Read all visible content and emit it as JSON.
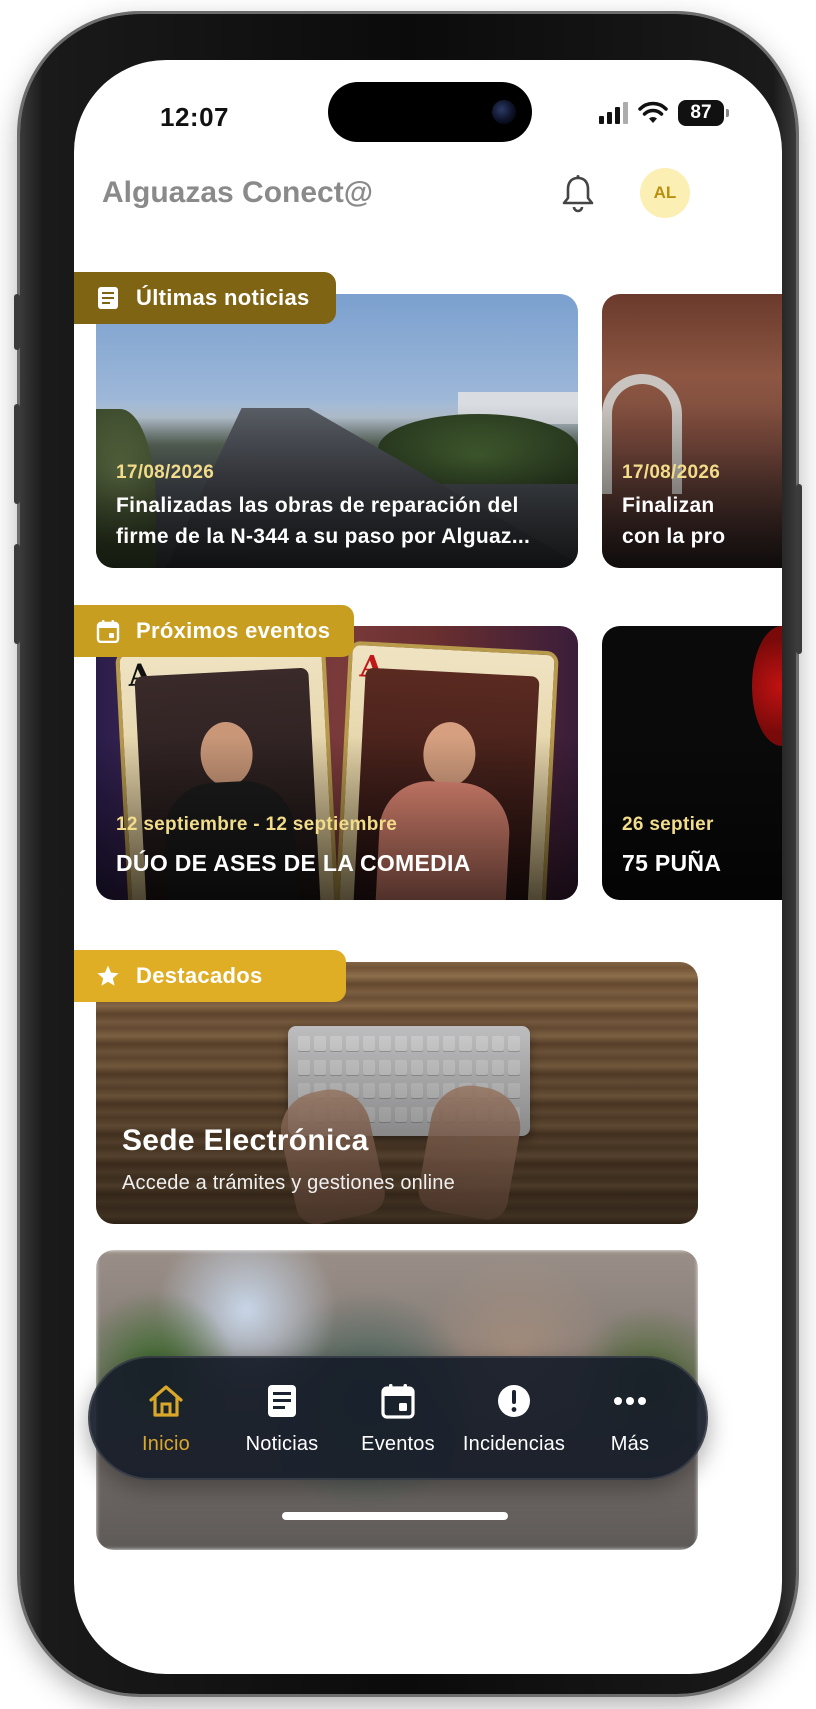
{
  "status_bar": {
    "time": "12:07",
    "battery": "87"
  },
  "app_bar": {
    "title": "Alguazas Conect@",
    "avatar_initials": "AL"
  },
  "sections": {
    "news": {
      "badge": "Últimas noticias",
      "items": [
        {
          "date": "17/08/2026",
          "title": "Finalizadas las obras de reparación del firme de la N-344 a su paso por Alguaz..."
        },
        {
          "date": "17/08/2026",
          "title": "Finalizan\ncon la pro"
        }
      ]
    },
    "events": {
      "badge": "Próximos eventos",
      "items": [
        {
          "date": "12 septiembre - 12 septiembre",
          "title": "DÚO DE ASES DE LA COMEDIA"
        },
        {
          "date": "26 septier",
          "title": "75 PUÑA"
        }
      ]
    },
    "featured": {
      "badge": "Destacados",
      "items": [
        {
          "title": "Sede Electrónica",
          "subtitle": "Accede a trámites y gestiones online"
        }
      ]
    }
  },
  "bottom_nav": {
    "items": [
      {
        "label": "Inicio",
        "icon": "home-icon",
        "active": true
      },
      {
        "label": "Noticias",
        "icon": "news-icon",
        "active": false
      },
      {
        "label": "Eventos",
        "icon": "calendar-icon",
        "active": false
      },
      {
        "label": "Incidencias",
        "icon": "alert-icon",
        "active": false
      },
      {
        "label": "Más",
        "icon": "more-icon",
        "active": false
      }
    ]
  },
  "colors": {
    "accent": "#d9a82b",
    "news_badge": "#7f6414",
    "events_badge": "#c79e20",
    "featured_badge": "#dfae24",
    "avatar_bg": "#fbefb3"
  }
}
